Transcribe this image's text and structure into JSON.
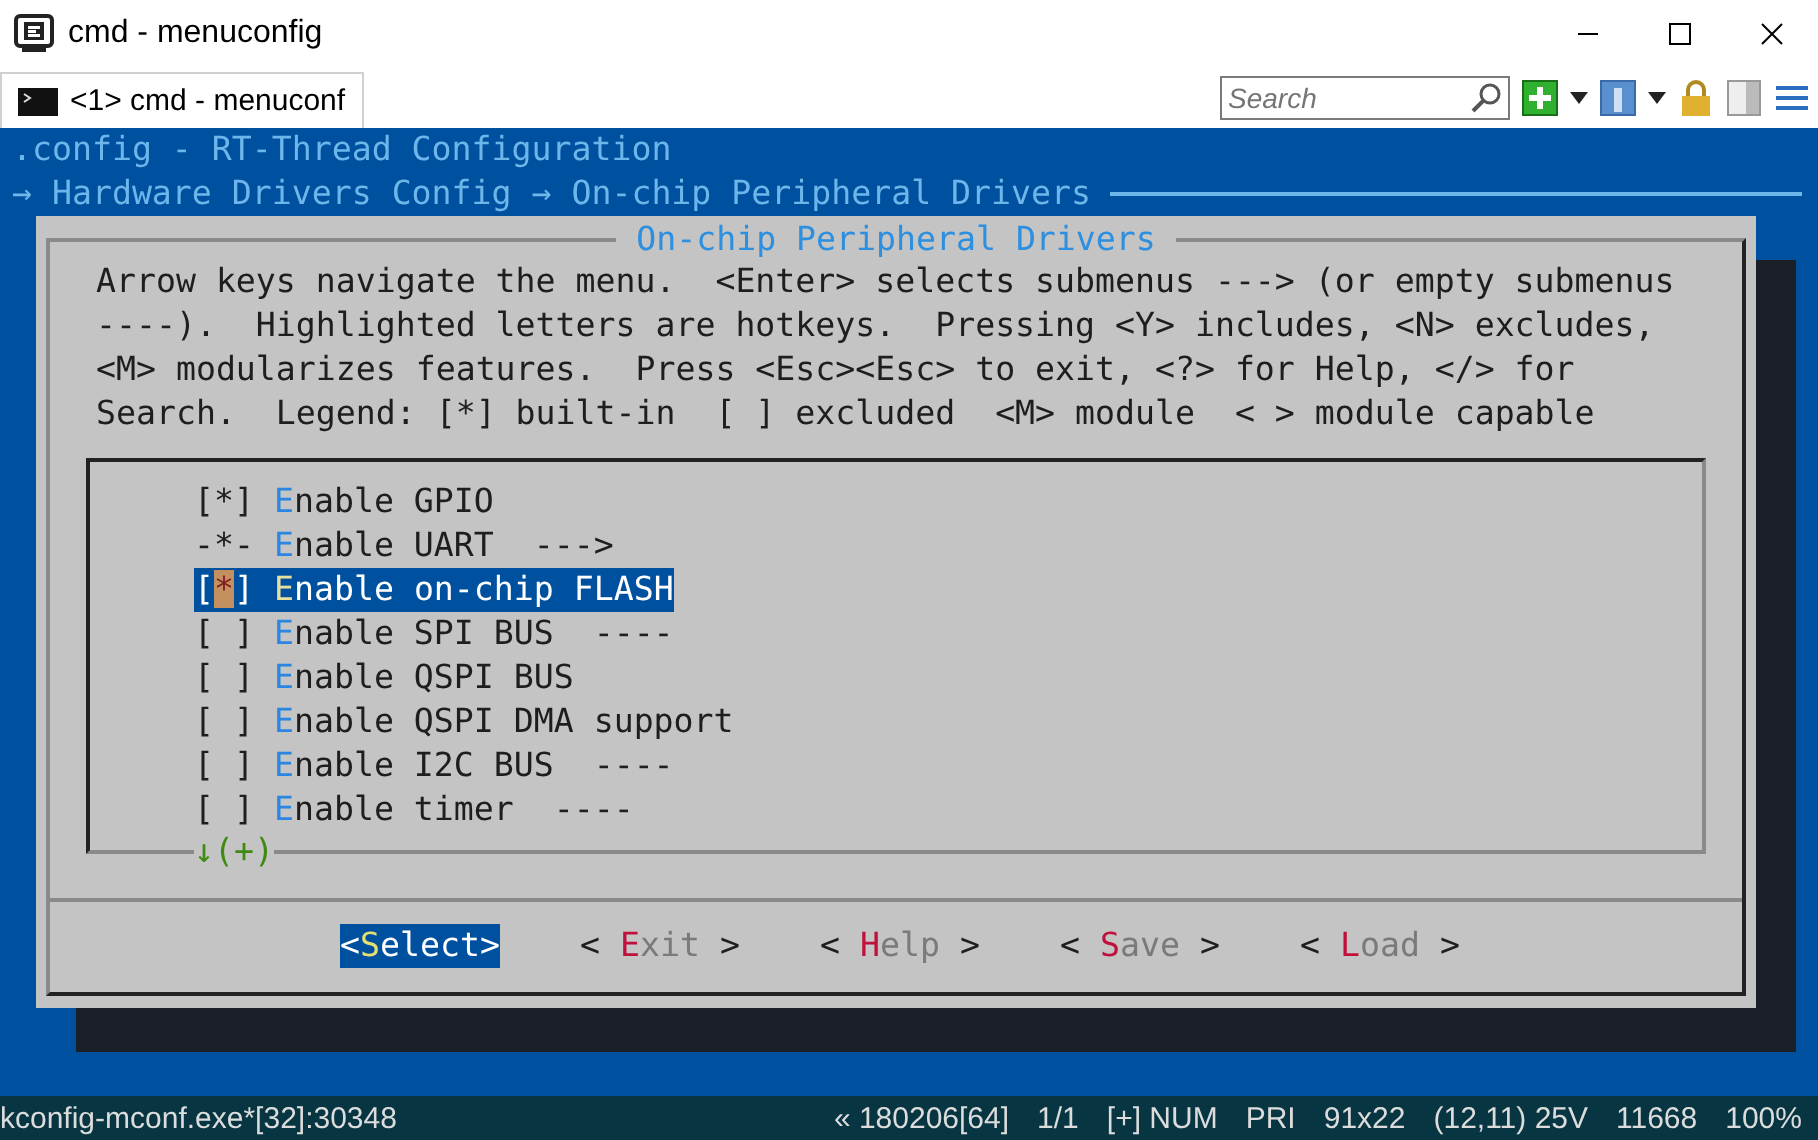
{
  "window": {
    "title": "cmd - menuconfig"
  },
  "tabs": [
    {
      "label": "<1> cmd - menuconf",
      "selected": true
    }
  ],
  "search": {
    "placeholder": "Search"
  },
  "terminal": {
    "header": ".config - RT-Thread Configuration",
    "breadcrumb": "→ Hardware Drivers Config → On-chip Peripheral Drivers",
    "dialog": {
      "title": "On-chip Peripheral Drivers",
      "help_lines": [
        "Arrow keys navigate the menu.  <Enter> selects submenus ---> (or empty submenus",
        "----).  Highlighted letters are hotkeys.  Pressing <Y> includes, <N> excludes,",
        "<M> modularizes features.  Press <Esc><Esc> to exit, <?> for Help, </> for",
        "Search.  Legend: [*] built-in  [ ] excluded  <M> module  < > module capable"
      ],
      "items": [
        {
          "prefix": "[*]",
          "label": "Enable GPIO",
          "selected": false
        },
        {
          "prefix": "-*-",
          "label": "Enable UART",
          "suffix": "--->",
          "selected": false
        },
        {
          "prefix": "[*]",
          "label": "Enable on-chip FLASH",
          "selected": true
        },
        {
          "prefix": "[ ]",
          "label": "Enable SPI BUS",
          "suffix": "----",
          "selected": false
        },
        {
          "prefix": "[ ]",
          "label": "Enable QSPI BUS",
          "selected": false
        },
        {
          "prefix": "[ ]",
          "label": "Enable QSPI DMA support",
          "selected": false
        },
        {
          "prefix": "[ ]",
          "label": "Enable I2C BUS",
          "suffix": "----",
          "selected": false
        },
        {
          "prefix": "[ ]",
          "label": "Enable timer",
          "suffix": "----",
          "selected": false
        }
      ],
      "scroll_indicator": "↓(+)",
      "buttons": [
        {
          "open": "<",
          "label": "Select",
          "close": ">",
          "selected": true
        },
        {
          "open": "<",
          "label": "Exit",
          "close": ">",
          "selected": false
        },
        {
          "open": "<",
          "label": "Help",
          "close": ">",
          "selected": false
        },
        {
          "open": "<",
          "label": "Save",
          "close": ">",
          "selected": false
        },
        {
          "open": "<",
          "label": "Load",
          "close": ">",
          "selected": false
        }
      ]
    }
  },
  "status_bar": {
    "left": "kconfig-mconf.exe*[32]:30348",
    "items": [
      "« 180206[64]",
      "1/1",
      "[+] NUM",
      "PRI",
      "91x22",
      "(12,11) 25V",
      "11668",
      "100%"
    ]
  }
}
